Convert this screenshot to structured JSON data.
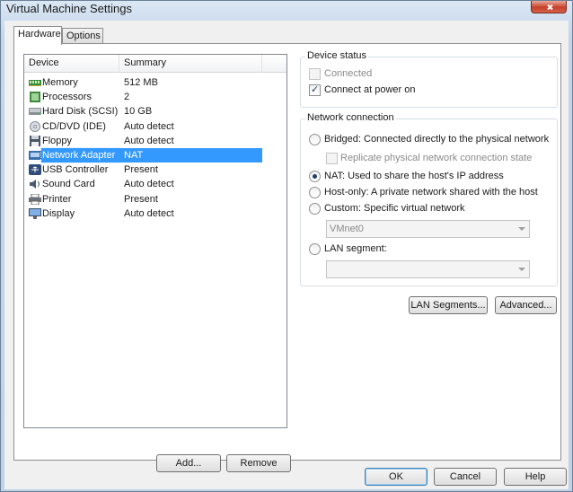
{
  "window": {
    "title": "Virtual Machine Settings"
  },
  "tabs": [
    {
      "label": "Hardware",
      "active": true
    },
    {
      "label": "Options",
      "active": false
    }
  ],
  "device_list": {
    "columns": [
      "Device",
      "Summary"
    ],
    "rows": [
      {
        "device": "Memory",
        "summary": "512 MB",
        "icon": "memory-icon",
        "selected": false
      },
      {
        "device": "Processors",
        "summary": "2",
        "icon": "processor-icon",
        "selected": false
      },
      {
        "device": "Hard Disk (SCSI)",
        "summary": "10 GB",
        "icon": "hard-disk-icon",
        "selected": false
      },
      {
        "device": "CD/DVD (IDE)",
        "summary": "Auto detect",
        "icon": "cd-dvd-icon",
        "selected": false
      },
      {
        "device": "Floppy",
        "summary": "Auto detect",
        "icon": "floppy-icon",
        "selected": false
      },
      {
        "device": "Network Adapter",
        "summary": "NAT",
        "icon": "network-adapter-icon",
        "selected": true
      },
      {
        "device": "USB Controller",
        "summary": "Present",
        "icon": "usb-icon",
        "selected": false
      },
      {
        "device": "Sound Card",
        "summary": "Auto detect",
        "icon": "sound-card-icon",
        "selected": false
      },
      {
        "device": "Printer",
        "summary": "Present",
        "icon": "printer-icon",
        "selected": false
      },
      {
        "device": "Display",
        "summary": "Auto detect",
        "icon": "display-icon",
        "selected": false
      }
    ],
    "add_label": "Add...",
    "remove_label": "Remove"
  },
  "device_status": {
    "legend": "Device status",
    "connected": {
      "label": "Connected",
      "checked": false,
      "enabled": false
    },
    "connect_at_power_on": {
      "label": "Connect at power on",
      "checked": true,
      "enabled": true
    }
  },
  "network_connection": {
    "legend": "Network connection",
    "bridged": {
      "label": "Bridged: Connected directly to the physical network",
      "checked": false
    },
    "replicate": {
      "label": "Replicate physical network connection state",
      "checked": false,
      "enabled": false
    },
    "nat": {
      "label": "NAT: Used to share the host's IP address",
      "checked": true
    },
    "host_only": {
      "label": "Host-only: A private network shared with the host",
      "checked": false
    },
    "custom": {
      "label": "Custom: Specific virtual network",
      "checked": false
    },
    "custom_value": "VMnet0",
    "lan_segment": {
      "label": "LAN segment:",
      "checked": false
    },
    "lan_segment_value": ""
  },
  "buttons": {
    "lan_segments": "LAN Segments...",
    "advanced": "Advanced...",
    "ok": "OK",
    "cancel": "Cancel",
    "help": "Help"
  },
  "colors": {
    "selection": "#3399ff",
    "title_bar": "#c3d5e9"
  }
}
